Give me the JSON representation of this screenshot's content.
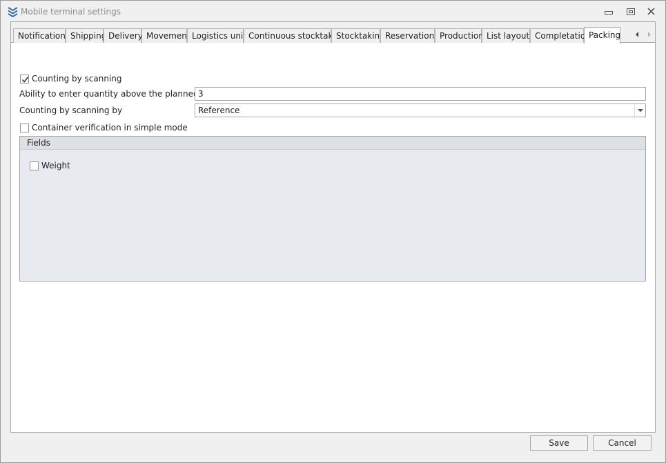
{
  "window": {
    "title": "Mobile terminal settings",
    "icons": {
      "app": "chevrons-logo-icon",
      "minimize": "minimize-icon",
      "restore": "restore-icon",
      "close": "close-icon"
    }
  },
  "tabs": [
    {
      "label": "Notifications"
    },
    {
      "label": "Shipping"
    },
    {
      "label": "Delivery"
    },
    {
      "label": "Movement"
    },
    {
      "label": "Logistics units"
    },
    {
      "label": "Continuous stocktaking"
    },
    {
      "label": "Stocktaking"
    },
    {
      "label": "Reservations"
    },
    {
      "label": "Production"
    },
    {
      "label": "List layouts"
    },
    {
      "label": "Completation"
    },
    {
      "label": "Packing"
    }
  ],
  "active_tab": "Packing",
  "packing": {
    "counting_by_scanning": {
      "label": "Counting by scanning",
      "checked": true
    },
    "above_planned": {
      "label": "Ability to enter quantity above the planned quantity",
      "value": "3"
    },
    "counting_by": {
      "label": "Counting by scanning by",
      "value": "Reference"
    },
    "container_verification": {
      "label": "Container verification in simple mode",
      "checked": false
    },
    "fields_group": {
      "title": "Fields",
      "weight": {
        "label": "Weight",
        "checked": false
      }
    }
  },
  "footer": {
    "save_label": "Save",
    "cancel_label": "Cancel"
  },
  "colors": {
    "tab_border": "#a6a6a6",
    "group_background": "#e7eaee",
    "logo_blue": "#3c6fa8"
  }
}
